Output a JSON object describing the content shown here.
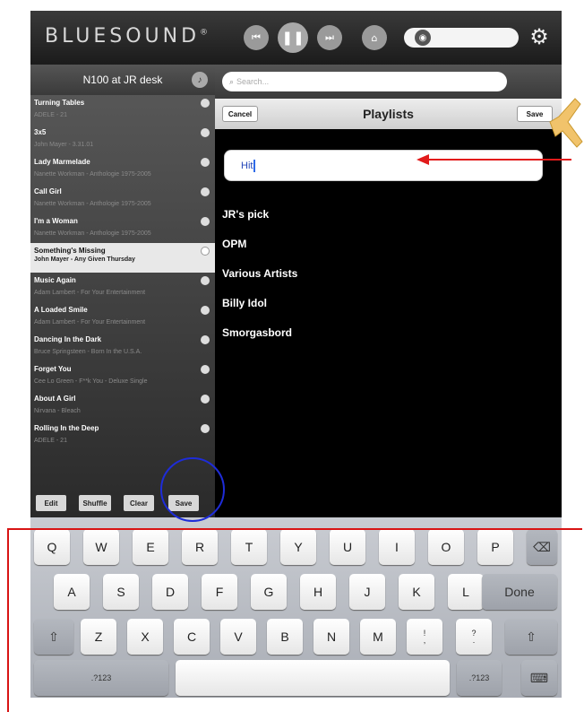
{
  "header": {
    "logo": "BLUESOUND",
    "logo_mark": "®",
    "prev_icon": "⏮",
    "pause_icon": "❚❚",
    "next_icon": "⏭",
    "home_icon": "⌂",
    "volume_icon": "🔊",
    "settings_icon": "⚙"
  },
  "sidebar": {
    "device": "N100 at JR desk",
    "queue": [
      {
        "title": "Turning Tables",
        "subtitle": "ADELE - 21"
      },
      {
        "title": "3x5",
        "subtitle": "John Mayer - 3.31.01"
      },
      {
        "title": "Lady Marmelade",
        "subtitle": "Nanette Workman - Anthologie 1975-2005"
      },
      {
        "title": "Call Girl",
        "subtitle": "Nanette Workman - Anthologie 1975-2005"
      },
      {
        "title": "I'm a Woman",
        "subtitle": "Nanette Workman - Anthologie 1975-2005"
      },
      {
        "title": "Something's Missing",
        "subtitle": "John Mayer - Any Given Thursday"
      },
      {
        "title": "Music Again",
        "subtitle": "Adam Lambert - For Your Entertainment"
      },
      {
        "title": "A Loaded Smile",
        "subtitle": "Adam Lambert - For Your Entertainment"
      },
      {
        "title": "Dancing In the Dark",
        "subtitle": "Bruce Springsteen - Born In the U.S.A."
      },
      {
        "title": "Forget You",
        "subtitle": "Cee Lo Green - F**k You - Deluxe Single"
      },
      {
        "title": "About A Girl",
        "subtitle": "Nirvana - Bleach"
      },
      {
        "title": "Rolling In the Deep",
        "subtitle": "ADELE - 21"
      }
    ],
    "actions": {
      "edit": "Edit",
      "shuffle": "Shuffle",
      "clear": "Clear",
      "save": "Save"
    }
  },
  "search": {
    "placeholder": "Search..."
  },
  "playlists": {
    "cancel": "Cancel",
    "title": "Playlists",
    "save": "Save",
    "name_value": "Hit",
    "items": [
      "JR's pick",
      "OPM",
      "Various Artists",
      "Billy Idol",
      "Smorgasbord"
    ]
  },
  "keyboard": {
    "row1": [
      "Q",
      "W",
      "E",
      "R",
      "T",
      "Y",
      "U",
      "I",
      "O",
      "P"
    ],
    "row2": [
      "A",
      "S",
      "D",
      "F",
      "G",
      "H",
      "J",
      "K",
      "L"
    ],
    "row3": [
      "Z",
      "X",
      "C",
      "V",
      "B",
      "N",
      "M"
    ],
    "done": "Done",
    "num": ".?123",
    "excl": "!",
    "comma": ",",
    "quest": "?",
    "period": ".",
    "backspace_icon": "⌫",
    "shift_icon": "⇧",
    "hide_icon": "⌨"
  },
  "colors": {
    "annotation_blue": "#1e2cd8",
    "annotation_red": "#e21b1b"
  }
}
